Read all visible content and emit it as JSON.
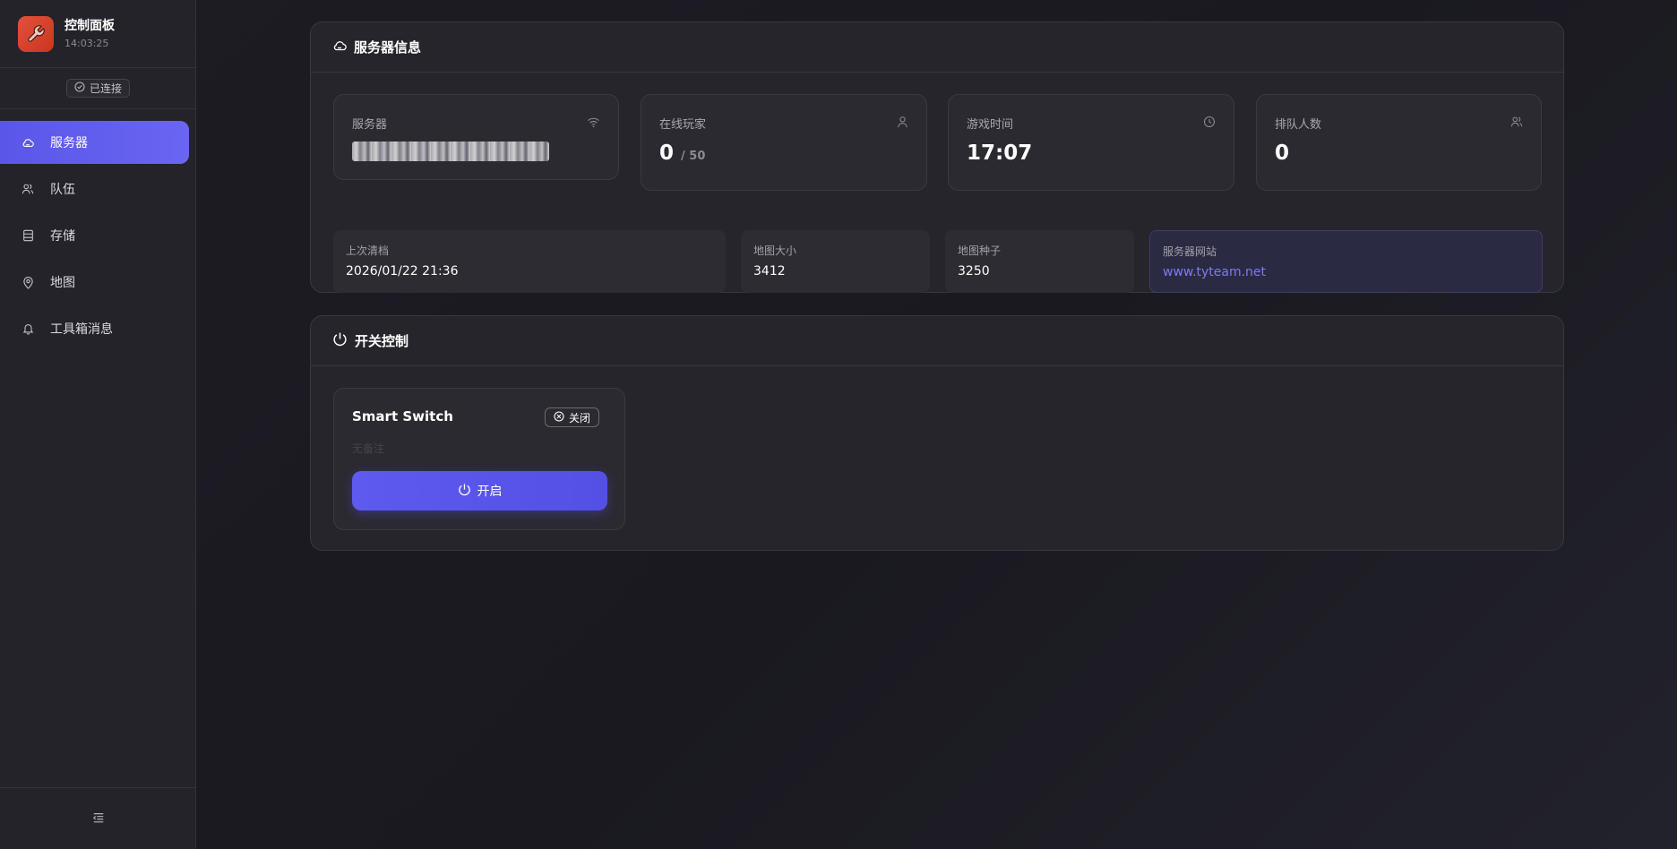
{
  "sidebar": {
    "title": "控制面板",
    "time": "14:03:25",
    "connection_status": "已连接",
    "nav": [
      {
        "label": "服务器",
        "icon": "cloud-icon",
        "active": true
      },
      {
        "label": "队伍",
        "icon": "users-icon",
        "active": false
      },
      {
        "label": "存储",
        "icon": "storage-icon",
        "active": false
      },
      {
        "label": "地图",
        "icon": "map-pin-icon",
        "active": false
      },
      {
        "label": "工具箱消息",
        "icon": "bell-icon",
        "active": false
      }
    ],
    "collapse_icon": "collapse-menu-icon"
  },
  "server_info": {
    "title": "服务器信息",
    "stats": {
      "server": {
        "label": "服务器",
        "icon": "wifi-icon"
      },
      "players": {
        "label": "在线玩家",
        "value": "0",
        "max": "/ 50",
        "icon": "user-icon"
      },
      "game_time": {
        "label": "游戏时间",
        "value": "17:07",
        "icon": "clock-icon"
      },
      "queue": {
        "label": "排队人数",
        "value": "0",
        "icon": "queue-users-icon"
      }
    },
    "details": {
      "last_wipe": {
        "label": "上次清档",
        "value": "2026/01/22 21:36"
      },
      "map_size": {
        "label": "地图大小",
        "value": "3412"
      },
      "map_seed": {
        "label": "地图种子",
        "value": "3250"
      },
      "website": {
        "label": "服务器网站",
        "value": "www.tyteam.net"
      }
    }
  },
  "switch_control": {
    "title": "开关控制",
    "switch": {
      "name": "Smart Switch",
      "status": "关闭",
      "note": "无备注",
      "button_label": "开启"
    }
  },
  "colors": {
    "accent": "#5a56e8",
    "brand": "#e3513a",
    "link": "#7d7bf0"
  }
}
